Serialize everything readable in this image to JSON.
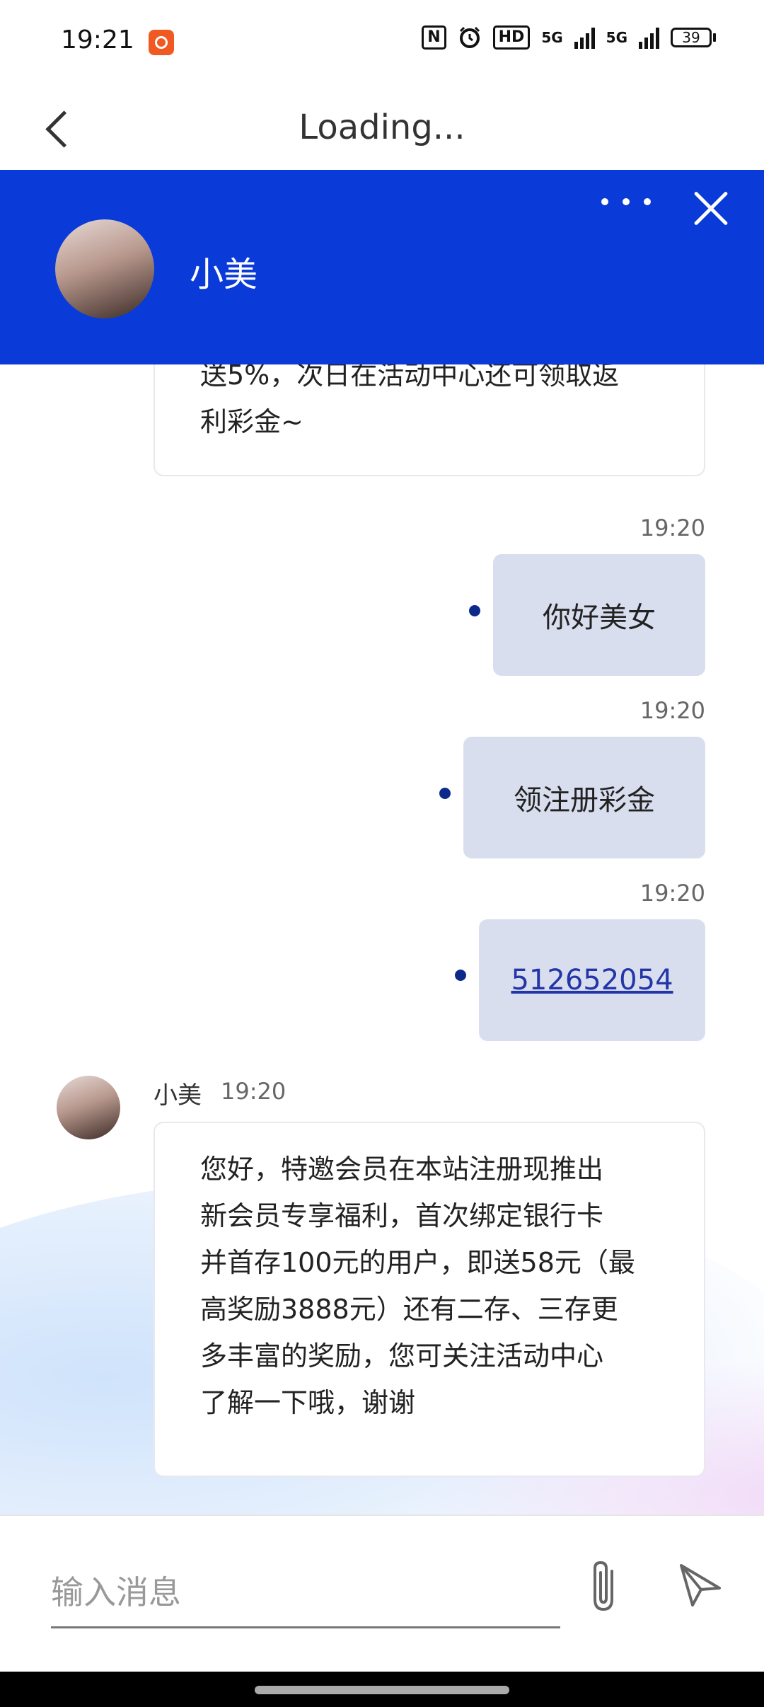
{
  "status_bar": {
    "time": "19:21",
    "nfc": "N",
    "hd": "HD",
    "signal1": "5G",
    "signal2": "5G",
    "battery": "39"
  },
  "nav": {
    "title": "Loading..."
  },
  "chat_header": {
    "agent_name": "小美"
  },
  "messages": [
    {
      "type": "incoming-partial",
      "lines": [
        "送5%，次日在活动中心还可领取返",
        "利彩金~"
      ]
    },
    {
      "type": "outgoing",
      "time": "19:20",
      "text": "你好美女"
    },
    {
      "type": "outgoing",
      "time": "19:20",
      "text": "领注册彩金"
    },
    {
      "type": "outgoing",
      "time": "19:20",
      "text": "512652054",
      "is_link": true
    },
    {
      "type": "incoming",
      "sender": "小美",
      "time": "19:20",
      "lines": [
        "您好，特邀会员在本站注册现推出",
        "新会员专享福利，首次绑定银行卡",
        "并首存100元的用户，即送58元（最",
        "高奖励3888元）还有二存、三存更",
        "多丰富的奖励，您可关注活动中心",
        "了解一下哦，谢谢"
      ]
    }
  ],
  "input": {
    "placeholder": "输入消息",
    "value": ""
  },
  "colors": {
    "header": "#0a3bd8",
    "outgoing_bubble": "#d9deef",
    "link": "#2335a8"
  },
  "icons": [
    "back-arrow-icon",
    "more-icon",
    "close-icon",
    "paperclip-icon",
    "send-icon"
  ]
}
